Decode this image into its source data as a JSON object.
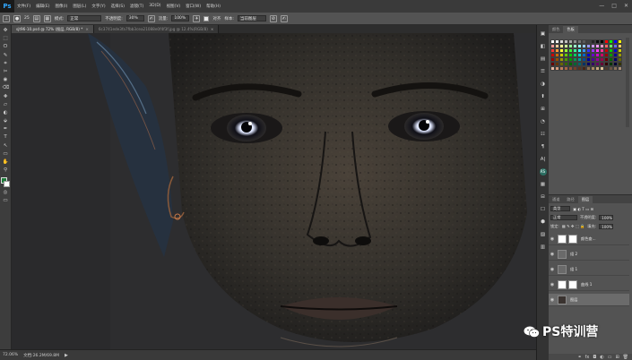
{
  "app": {
    "logo": "Ps"
  },
  "menu": [
    "文件(F)",
    "编辑(E)",
    "图像(I)",
    "图层(L)",
    "文字(Y)",
    "选择(S)",
    "滤镜(T)",
    "3D(D)",
    "视图(V)",
    "窗口(W)",
    "帮助(H)"
  ],
  "window_controls": [
    "—",
    "□",
    "✕"
  ],
  "options": {
    "tool_icon": "stamp-icon",
    "brush_size": "25",
    "mode_label": "模式:",
    "mode_value": "正常",
    "opacity_label": "不透明度:",
    "opacity_value": "30%",
    "flow_label": "流量:",
    "flow_value": "100%",
    "aligned_label": "对齐",
    "sample_label": "样本:",
    "sample_value": "当前图层"
  },
  "tabs": [
    {
      "label": "sjt96-10.psd @ 72% (图层, RGB/8) *",
      "active": true
    },
    {
      "label": "6c3741ede3fa7fbb3cea21088e0f4f3f.jpg @ 12.4%(RGB/8)",
      "active": false
    }
  ],
  "tools": [
    "✥",
    "⬚",
    "ⵔ",
    "✎",
    "⌗",
    "✂",
    "◉",
    "⌫",
    "✚",
    "▱",
    "◐",
    "⬙",
    "✒",
    "T",
    "↖",
    "▭",
    "✋",
    "⚲"
  ],
  "status": {
    "zoom": "72.06%",
    "doc": "文档:26.2M/69.8M"
  },
  "right_icons": [
    "▣",
    "◧",
    "▤",
    "☰",
    "◑",
    "⬆",
    "⊞",
    "◔",
    "☷",
    "¶",
    "A|",
    "▦",
    "⊟",
    "☐",
    "⬢",
    "▨",
    "▥"
  ],
  "rs_label": "RS",
  "swatches_panel": {
    "tabs": [
      "颜色",
      "色板"
    ],
    "active": 1
  },
  "layers_panel": {
    "tabs": [
      "通道",
      "路径",
      "图层"
    ],
    "active": 2,
    "kind_label": "类型",
    "blend_mode": "正常",
    "opacity_label": "不透明度:",
    "opacity_value": "100%",
    "lock_label": "锁定:",
    "fill_label": "填充:",
    "fill_value": "100%",
    "layers": [
      {
        "name": "颜色查...",
        "selected": false
      },
      {
        "name": "组 2",
        "selected": false
      },
      {
        "name": "组 1",
        "selected": false
      },
      {
        "name": "曲线 1",
        "selected": false
      },
      {
        "name": "图层",
        "selected": true
      }
    ]
  },
  "watermark": "PS特训营",
  "colors": {
    "foreground": "#1e7b3a",
    "background": "#ffffff",
    "swatches": [
      "#ffffff",
      "#f2f2f2",
      "#d9d9d9",
      "#bfbfbf",
      "#a6a6a6",
      "#8c8c8c",
      "#737373",
      "#595959",
      "#404040",
      "#262626",
      "#0d0d0d",
      "#000000",
      "#ff0000",
      "#00ff00",
      "#0000ff",
      "#ffff00",
      "#ff9999",
      "#ffcc99",
      "#ffff99",
      "#ccff99",
      "#99ff99",
      "#99ffcc",
      "#99ffff",
      "#99ccff",
      "#9999ff",
      "#cc99ff",
      "#ff99ff",
      "#ff99cc",
      "#ff6666",
      "#66ff66",
      "#6666ff",
      "#ffcc66",
      "#ff3333",
      "#ff9933",
      "#ffff33",
      "#99ff33",
      "#33ff33",
      "#33ff99",
      "#33ffff",
      "#3399ff",
      "#3333ff",
      "#9933ff",
      "#ff33ff",
      "#ff3399",
      "#cc0000",
      "#00cc00",
      "#0000cc",
      "#cccc00",
      "#cc0000",
      "#cc6600",
      "#cccc00",
      "#66cc00",
      "#00cc00",
      "#00cc66",
      "#00cccc",
      "#0066cc",
      "#0000cc",
      "#6600cc",
      "#cc00cc",
      "#cc0066",
      "#990000",
      "#009900",
      "#000099",
      "#999900",
      "#990000",
      "#994c00",
      "#999900",
      "#4c9900",
      "#009900",
      "#00994c",
      "#009999",
      "#004c99",
      "#000099",
      "#4c0099",
      "#990099",
      "#99004c",
      "#660000",
      "#006600",
      "#000066",
      "#666600",
      "#660000",
      "#663300",
      "#666600",
      "#336600",
      "#006600",
      "#006633",
      "#006666",
      "#003366",
      "#000066",
      "#330066",
      "#660066",
      "#660033",
      "#330000",
      "#003300",
      "#000033",
      "#333300",
      "#e6b8a2",
      "#d49a7a",
      "#c07e5c",
      "#a86646",
      "#8f5236",
      "#744028",
      "#5c311e",
      "#462416",
      "#8a6d4e",
      "#a88963",
      "#c6a67b",
      "#e0c49a",
      "#4d3b2e",
      "#6b5442",
      "#8a705a",
      "#a98d74"
    ]
  }
}
